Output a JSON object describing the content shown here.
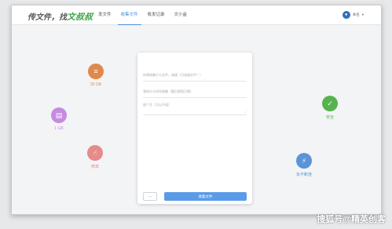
{
  "header": {
    "logo_main": "传文件，找",
    "logo_accent": "文叔叔",
    "nav": [
      "发文件",
      "收集文件",
      "收发记录",
      "文小盒"
    ],
    "active_nav": 1,
    "user_name": "本名",
    "caret": "▾"
  },
  "features": [
    {
      "label": "20 GB",
      "icon": "database-icon",
      "glyph": "≡",
      "color": "#e0894d"
    },
    {
      "label": "1 GB",
      "icon": "document-icon",
      "glyph": "▤",
      "color": "#c58be0"
    },
    {
      "label": "简单",
      "icon": "pointer-hand-icon",
      "glyph": "☝",
      "color": "#e68a8a"
    },
    {
      "label": "安全",
      "icon": "shield-check-icon",
      "glyph": "✓",
      "color": "#56b34e"
    },
    {
      "label": "永不断连",
      "icon": "lightning-icon",
      "glyph": "⚡",
      "color": "#5b93d8"
    }
  ],
  "form": {
    "field1_placeholder": "你想收集什么文件，请填（可选填文件？）",
    "field2_placeholder": "我的什么时间收集（最后期限日期）",
    "field3_placeholder": "留个言（可以不留）",
    "more_label": "···",
    "submit_label": "收集文件"
  },
  "watermark": "搜狐号@精英创客"
}
